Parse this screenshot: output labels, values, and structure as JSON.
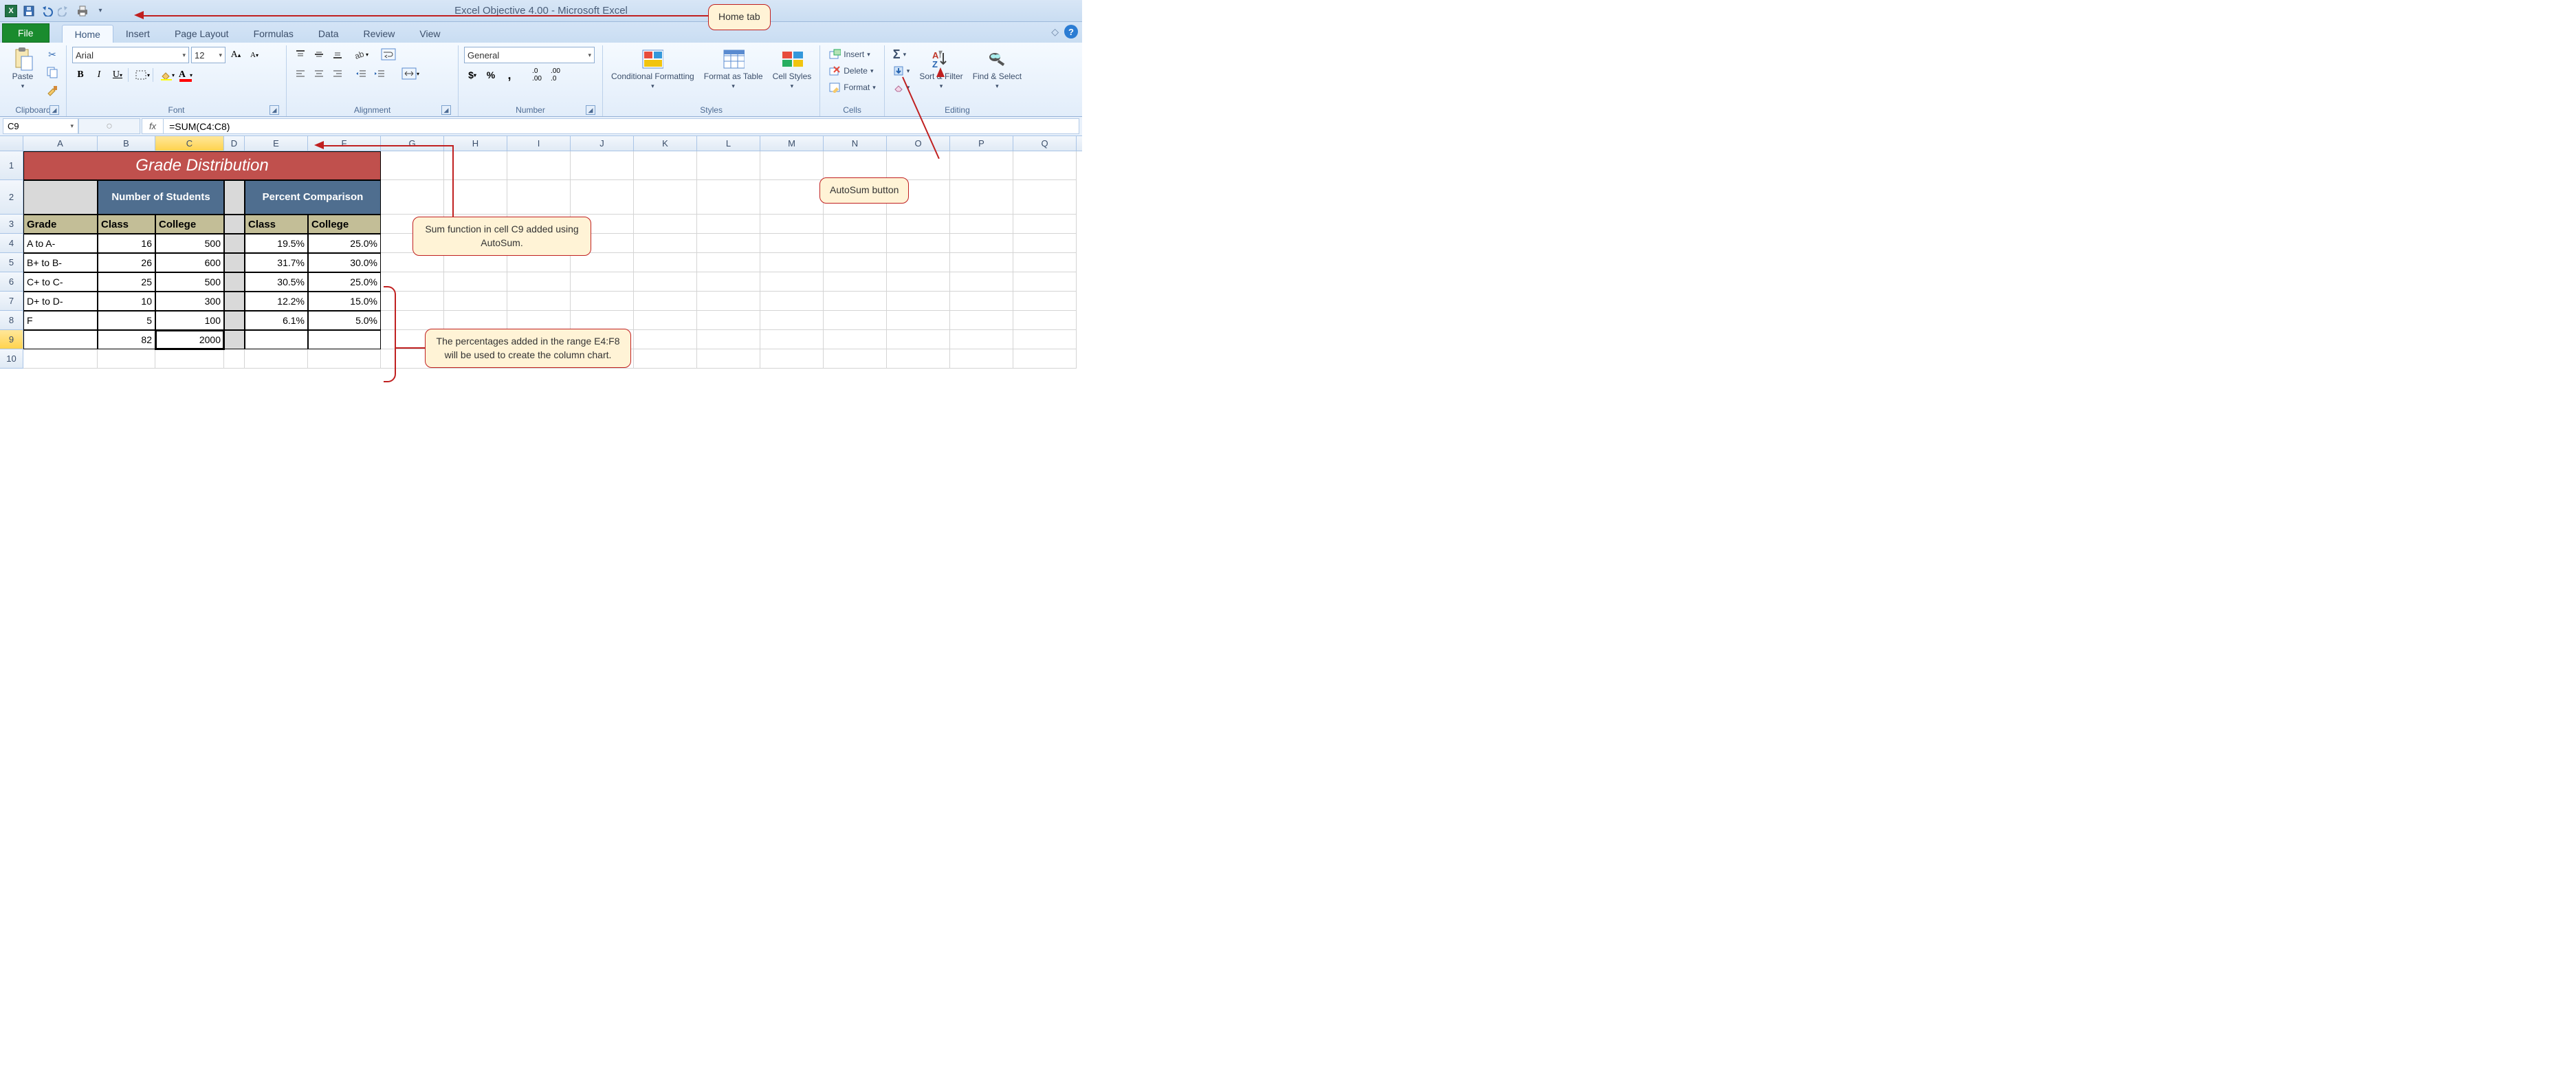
{
  "app": {
    "title": "Excel Objective 4.00 - Microsoft Excel"
  },
  "tabs": {
    "file": "File",
    "home": "Home",
    "insert": "Insert",
    "pagelayout": "Page Layout",
    "formulas": "Formulas",
    "data": "Data",
    "review": "Review",
    "view": "View"
  },
  "ribbon": {
    "clipboard": {
      "label": "Clipboard",
      "paste": "Paste"
    },
    "font": {
      "label": "Font",
      "name": "Arial",
      "size": "12"
    },
    "alignment": {
      "label": "Alignment"
    },
    "number": {
      "label": "Number",
      "format": "General"
    },
    "styles": {
      "label": "Styles",
      "cond": "Conditional Formatting",
      "fat": "Format as Table",
      "cell": "Cell Styles"
    },
    "cells_group": {
      "label": "Cells",
      "insert": "Insert",
      "delete": "Delete",
      "format": "Format"
    },
    "editing": {
      "label": "Editing",
      "sort": "Sort & Filter",
      "find": "Find & Select"
    }
  },
  "formula_bar": {
    "name_box": "C9",
    "formula": "=SUM(C4:C8)",
    "fx": "fx"
  },
  "columns": [
    "A",
    "B",
    "C",
    "D",
    "E",
    "F",
    "G",
    "H",
    "I",
    "J",
    "K",
    "L",
    "M",
    "N",
    "O",
    "P",
    "Q"
  ],
  "rows": [
    "1",
    "2",
    "3",
    "4",
    "5",
    "6",
    "7",
    "8",
    "9",
    "10"
  ],
  "sheet": {
    "title": "Grade Distribution",
    "hdr_num_students": "Number of Students",
    "hdr_pct_comp": "Percent Comparison",
    "col_grade": "Grade",
    "col_class_b": "Class",
    "col_college_c": "College",
    "col_class_e": "Class",
    "col_college_f": "College",
    "r4": {
      "a": "A to A-",
      "b": "16",
      "c": "500",
      "e": "19.5%",
      "f": "25.0%"
    },
    "r5": {
      "a": "B+ to B-",
      "b": "26",
      "c": "600",
      "e": "31.7%",
      "f": "30.0%"
    },
    "r6": {
      "a": "C+ to C-",
      "b": "25",
      "c": "500",
      "e": "30.5%",
      "f": "25.0%"
    },
    "r7": {
      "a": "D+ to D-",
      "b": "10",
      "c": "300",
      "e": "12.2%",
      "f": "15.0%"
    },
    "r8": {
      "a": "F",
      "b": "5",
      "c": "100",
      "e": "6.1%",
      "f": "5.0%"
    },
    "r9": {
      "b": "82",
      "c": "2000"
    }
  },
  "callouts": {
    "home_tab": "Home tab",
    "autosum": "AutoSum button",
    "sum_fn": "Sum function in cell C9 added using AutoSum.",
    "percents": "The percentages added in the range E4:F8 will be used to create the column chart."
  }
}
